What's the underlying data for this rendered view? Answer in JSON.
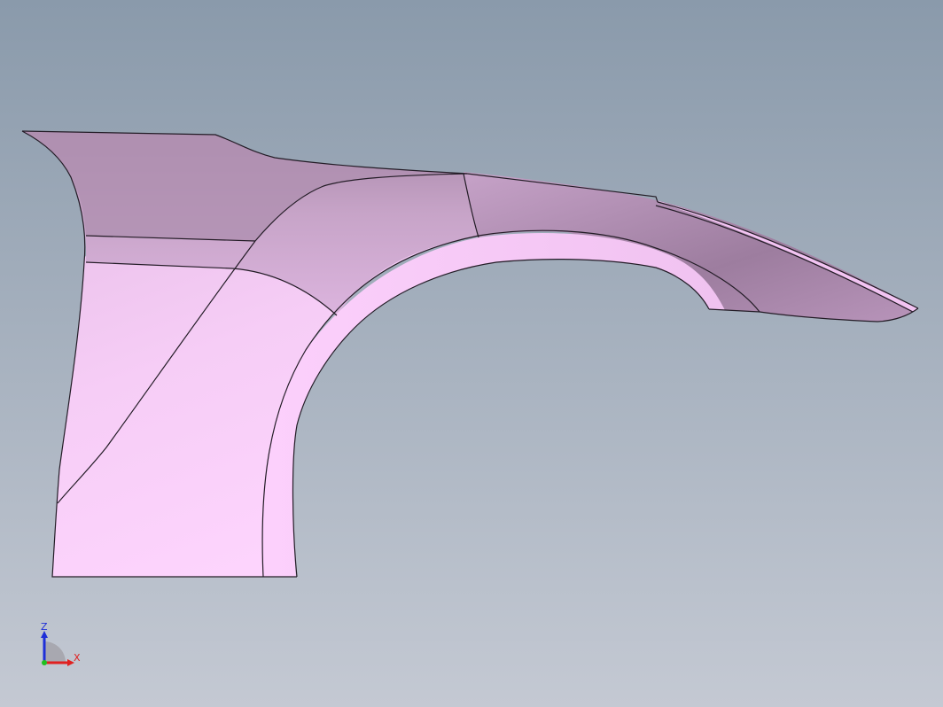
{
  "viewport": {
    "background_top": "#8b9bac",
    "background_bottom": "#c3c8d2",
    "model_color": "#fbcff8",
    "model_shadow": "#7d6b80",
    "edge_color": "#1f1a22"
  },
  "triad": {
    "z_label": "Z",
    "x_label": "X",
    "z_color": "#1f2fd8",
    "x_color": "#e02020",
    "origin_color": "#20c020"
  }
}
